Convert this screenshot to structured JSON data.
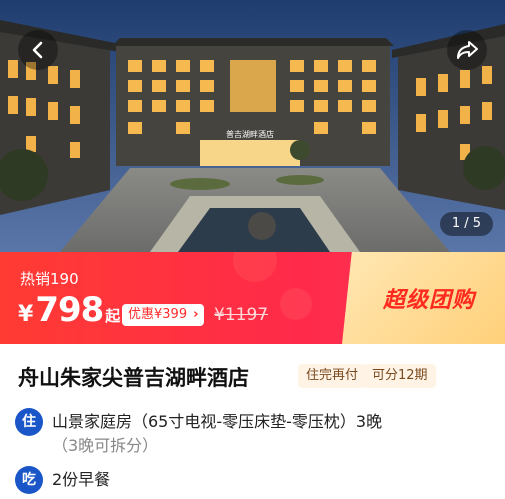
{
  "gallery": {
    "counter": "1 / 5"
  },
  "hotel_sign": "普吉湖畔酒店",
  "sales": {
    "label": "热销190"
  },
  "price": {
    "currency": "¥",
    "amount": "798",
    "suffix": "起",
    "coupon": "优惠¥399",
    "original": "¥1197"
  },
  "promo": {
    "title": "超级团购"
  },
  "product": {
    "title": "舟山朱家尖普吉湖畔酒店",
    "tags": [
      "住完再付",
      "可分12期"
    ]
  },
  "details": [
    {
      "icon_label": "住",
      "text": "山景家庭房（65寸电视-零压床垫-零压枕）3晚",
      "note": "（3晚可拆分）"
    },
    {
      "icon_label": "吃",
      "text": "2份早餐",
      "note": ""
    }
  ],
  "colors": {
    "accent_red": "#ff2a3f",
    "icon_blue": "#1a56c8",
    "promo_gold": "#ffd07a"
  },
  "icons": {
    "back": "chevron-left-icon",
    "share": "share-arrow-icon"
  }
}
